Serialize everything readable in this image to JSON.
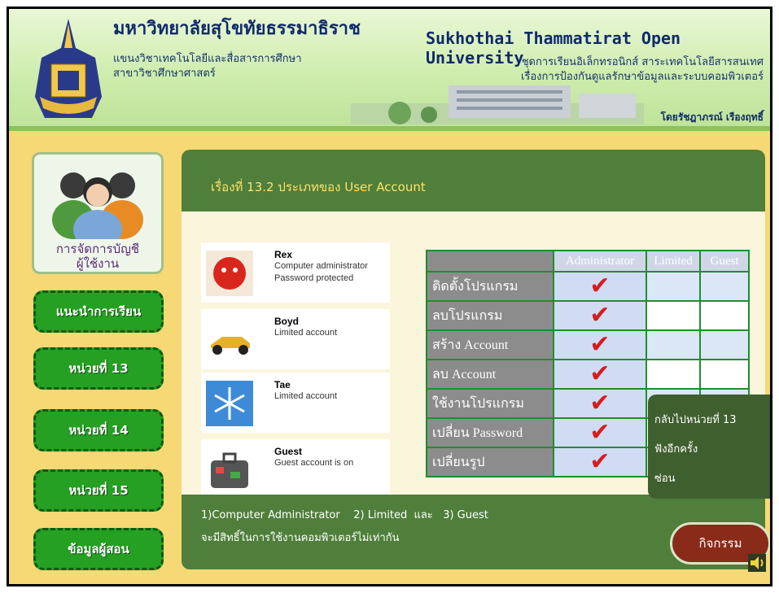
{
  "header": {
    "university_th": "มหาวิทยาลัยสุโขทัยธรรมาธิราช",
    "dept_line1": "แขนงวิชาเทคโนโลยีและสื่อสารการศึกษา",
    "dept_line2": "สาขาวิชาศึกษาศาสตร์",
    "university_en": "Sukhothai Thammatirat Open University",
    "course_line1": "ชุดการเรียนอิเล็กทรอนิกส์ สาระเทคโนโลยีสารสนเทศ",
    "course_line2": "เรื่องการป้องกันดูแลรักษาข้อมูลและระบบคอมพิวเตอร์",
    "author": "โดยรัชฎาภรณ์ เรืองฤทธิ์"
  },
  "sidebar": {
    "topic_line1": "การจัดการบัญชี",
    "topic_line2": "ผู้ใช้งาน",
    "items": [
      {
        "label": "แนะนำการเรียน"
      },
      {
        "label": "หน่วยที่ 13"
      },
      {
        "label": "หน่วยที่ 14"
      },
      {
        "label": "หน่วยที่ 15"
      },
      {
        "label": "ข้อมูลผู้สอน"
      }
    ]
  },
  "main": {
    "title": "เรื่องที่ 13.2 ประเภทของ User Account",
    "accounts": [
      {
        "name": "Rex",
        "line1": "Computer administrator",
        "line2": "Password protected"
      },
      {
        "name": "Boyd",
        "line1": "Limited account",
        "line2": ""
      },
      {
        "name": "Tae",
        "line1": "Limited account",
        "line2": ""
      },
      {
        "name": "Guest",
        "line1": "Guest account is on",
        "line2": ""
      }
    ],
    "table": {
      "headers": [
        "Administrator",
        "Limited",
        "Guest"
      ],
      "rows": [
        {
          "label": "ติดตั้งโปรแกรม",
          "admin": true
        },
        {
          "label": "ลบโปรแกรม",
          "admin": true
        },
        {
          "label": "สร้าง Account",
          "admin": true
        },
        {
          "label": "ลบ Account",
          "admin": true
        },
        {
          "label": "ใช้งานโปรแกรม",
          "admin": true
        },
        {
          "label": "เปลี่ยน Password",
          "admin": true
        },
        {
          "label": "เปลี่ยนรูป",
          "admin": true
        }
      ]
    },
    "summary_line1": "1)Computer Administrator    2) Limited  และ   3) Guest",
    "summary_line2": "จะมีสิทธิ์ในการใช้งานคอมพิวเตอร์ไม่เท่ากัน"
  },
  "popup": {
    "items": [
      "กลับไปหน่วยที่ 13",
      "ฟังอีกครั้ง",
      "ซ่อน"
    ]
  },
  "activity_button": "กิจกรรม",
  "colors": {
    "accent_green": "#25a022",
    "panel_green": "#4f7f3a",
    "title_yellow": "#ffe16a",
    "check_red": "#d81c1c",
    "activity_brown": "#8a2b1a"
  }
}
